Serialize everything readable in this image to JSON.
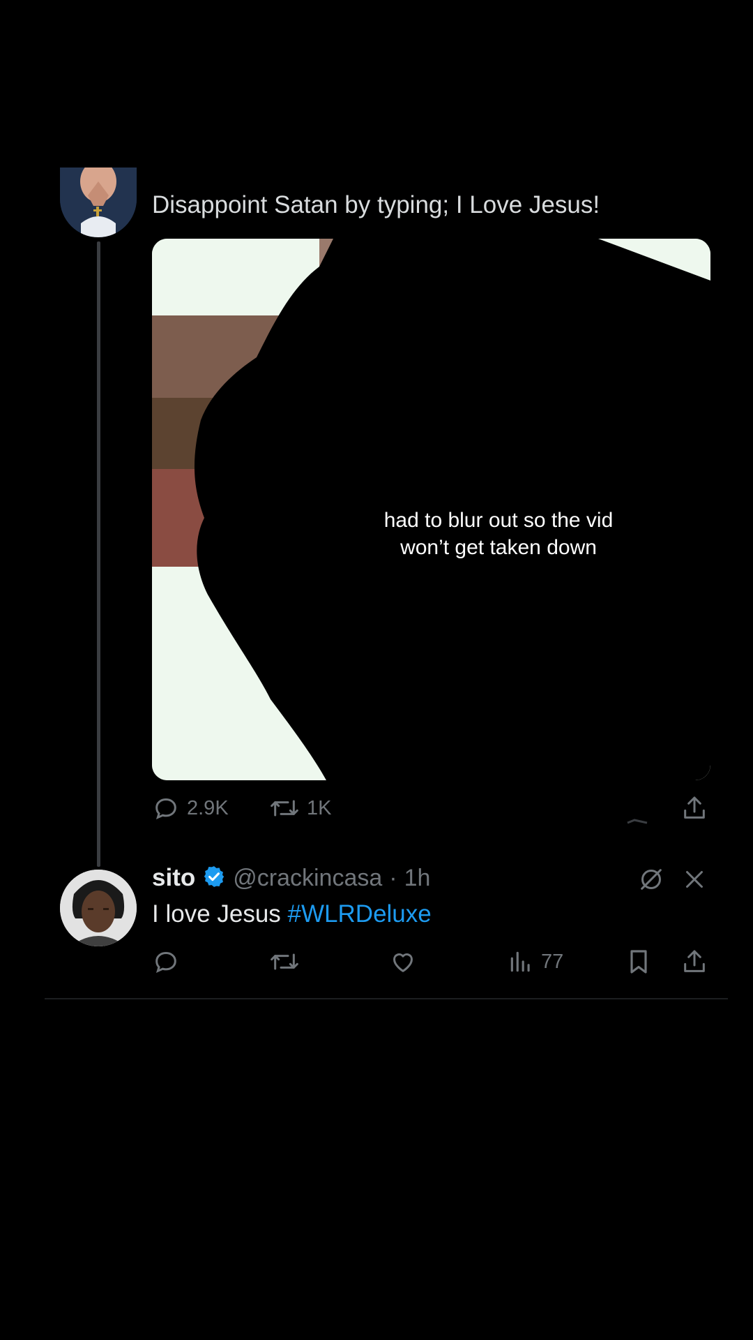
{
  "original_tweet": {
    "text": "Disappoint Satan by typing; I Love Jesus!",
    "media_caption": "had to blur out so the vid won’t get taken down",
    "actions": {
      "replies": "2.9K",
      "reposts": "1K"
    }
  },
  "reply_tweet": {
    "display_name": "sito",
    "verified": true,
    "handle": "@crackincasa",
    "separator": "·",
    "time": "1h",
    "text": "I love Jesus ",
    "hashtag": "#WLRDeluxe",
    "actions": {
      "views": "77"
    }
  },
  "colors": {
    "background": "#000000",
    "text_primary": "#e7e9ea",
    "text_secondary": "#71767b",
    "accent_blue": "#1d9bf0",
    "verified_badge": "#1d9bf0"
  },
  "icons": {
    "reply": "speech-bubble-icon",
    "repost": "repost-arrows-icon",
    "like": "heart-icon",
    "views": "bar-chart-icon",
    "bookmark": "bookmark-icon",
    "share": "share-upload-icon",
    "grok": "grok-slash-circle-icon",
    "close": "close-x-icon"
  }
}
